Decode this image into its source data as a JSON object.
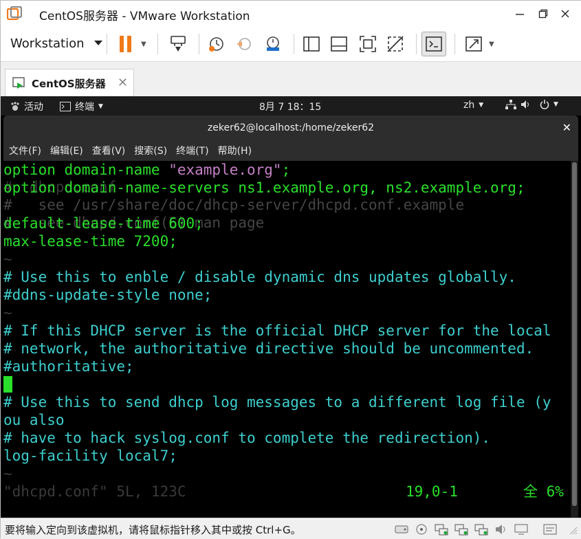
{
  "window": {
    "title": "CentOS服务器 - VMware Workstation"
  },
  "toolbar": {
    "workstation_label": "Workstation"
  },
  "tab": {
    "label": "CentOS服务器"
  },
  "gnome": {
    "activities": "活动",
    "app_menu": "终端",
    "clock": "8月 7  18：15",
    "lang": "zh"
  },
  "terminal": {
    "title": "zeker62@localhost:/home/zeker62",
    "menu": [
      "文件(F)",
      "编辑(E)",
      "查看(V)",
      "搜索(S)",
      "终端(T)",
      "帮助(H)"
    ],
    "ghost_lines": [
      "#  dhcpd.conf",
      "#",
      "#   see /usr/share/doc/dhcp-server/dhcpd.conf.example",
      "#   see dhcpd.conf(5) man page"
    ],
    "lines": [
      {
        "a": "option domain-name ",
        "b": "\"example.org\"",
        "c": ";"
      },
      {
        "a": "option domain-name-servers ns1.example.org, ns2.example.org;"
      },
      {
        "a": ""
      },
      {
        "a": "default-lease-time 600;"
      },
      {
        "a": "max-lease-time 7200;"
      },
      {
        "a": "~"
      },
      {
        "a": "# Use this to enble / disable dynamic dns updates globally."
      },
      {
        "a": "#ddns-update-style none;"
      },
      {
        "a": "~"
      },
      {
        "a": "# If this DHCP server is the official DHCP server for the local"
      },
      {
        "a": "# network, the authoritative directive should be uncommented."
      },
      {
        "a": "#authoritative;"
      },
      {
        "a": ""
      },
      {
        "a": "# Use this to send dhcp log messages to a different log file (y"
      },
      {
        "a": "ou also"
      },
      {
        "a": "# have to hack syslog.conf to complete the redirection)."
      },
      {
        "a": "log-facility local7;"
      },
      {
        "a": "~"
      }
    ],
    "status_file": "\"dhcpd.conf\" 5L, 123C",
    "status_pos": "19,0-1",
    "status_pct": "全 6%"
  },
  "statusbar": {
    "hint": "要将输入定向到该虚拟机，请将鼠标指针移入其中或按 Ctrl+G。"
  },
  "colors": {
    "pause_orange": "#f07a1a",
    "terminal_green": "#2ae02a",
    "terminal_cyan": "#3ecfcf"
  }
}
